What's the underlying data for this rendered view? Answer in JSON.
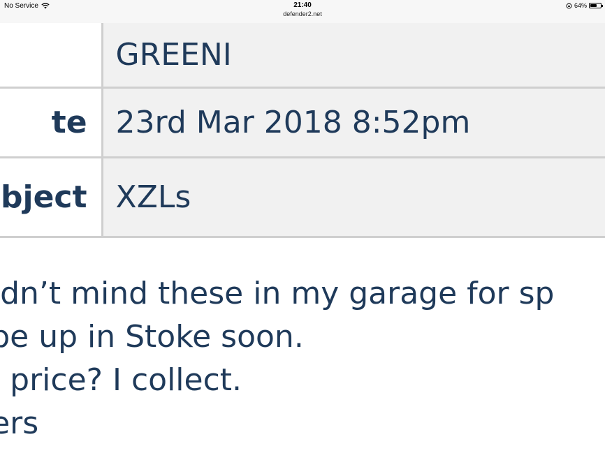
{
  "status_bar": {
    "carrier": "No Service",
    "time": "21:40",
    "url": "defender2.net",
    "battery_percent": "64%",
    "battery_level": 0.64,
    "icons": [
      "wifi-icon",
      "rotation-lock-icon",
      "battery-icon"
    ]
  },
  "info_table": {
    "rows": [
      {
        "label": "",
        "value": "GREENI"
      },
      {
        "label": "te",
        "value": "23rd Mar 2018 8:52pm"
      },
      {
        "label": "bject",
        "value": "XZLs"
      }
    ]
  },
  "message": {
    "lines": [
      "uldn’t mind these in my garage for sp",
      "l be up in Stoke soon.",
      "st price? I collect.",
      "eers"
    ]
  },
  "colors": {
    "text": "#1f3a5a",
    "table_value_bg": "#f1f1f1",
    "border": "#cfcfcf"
  }
}
